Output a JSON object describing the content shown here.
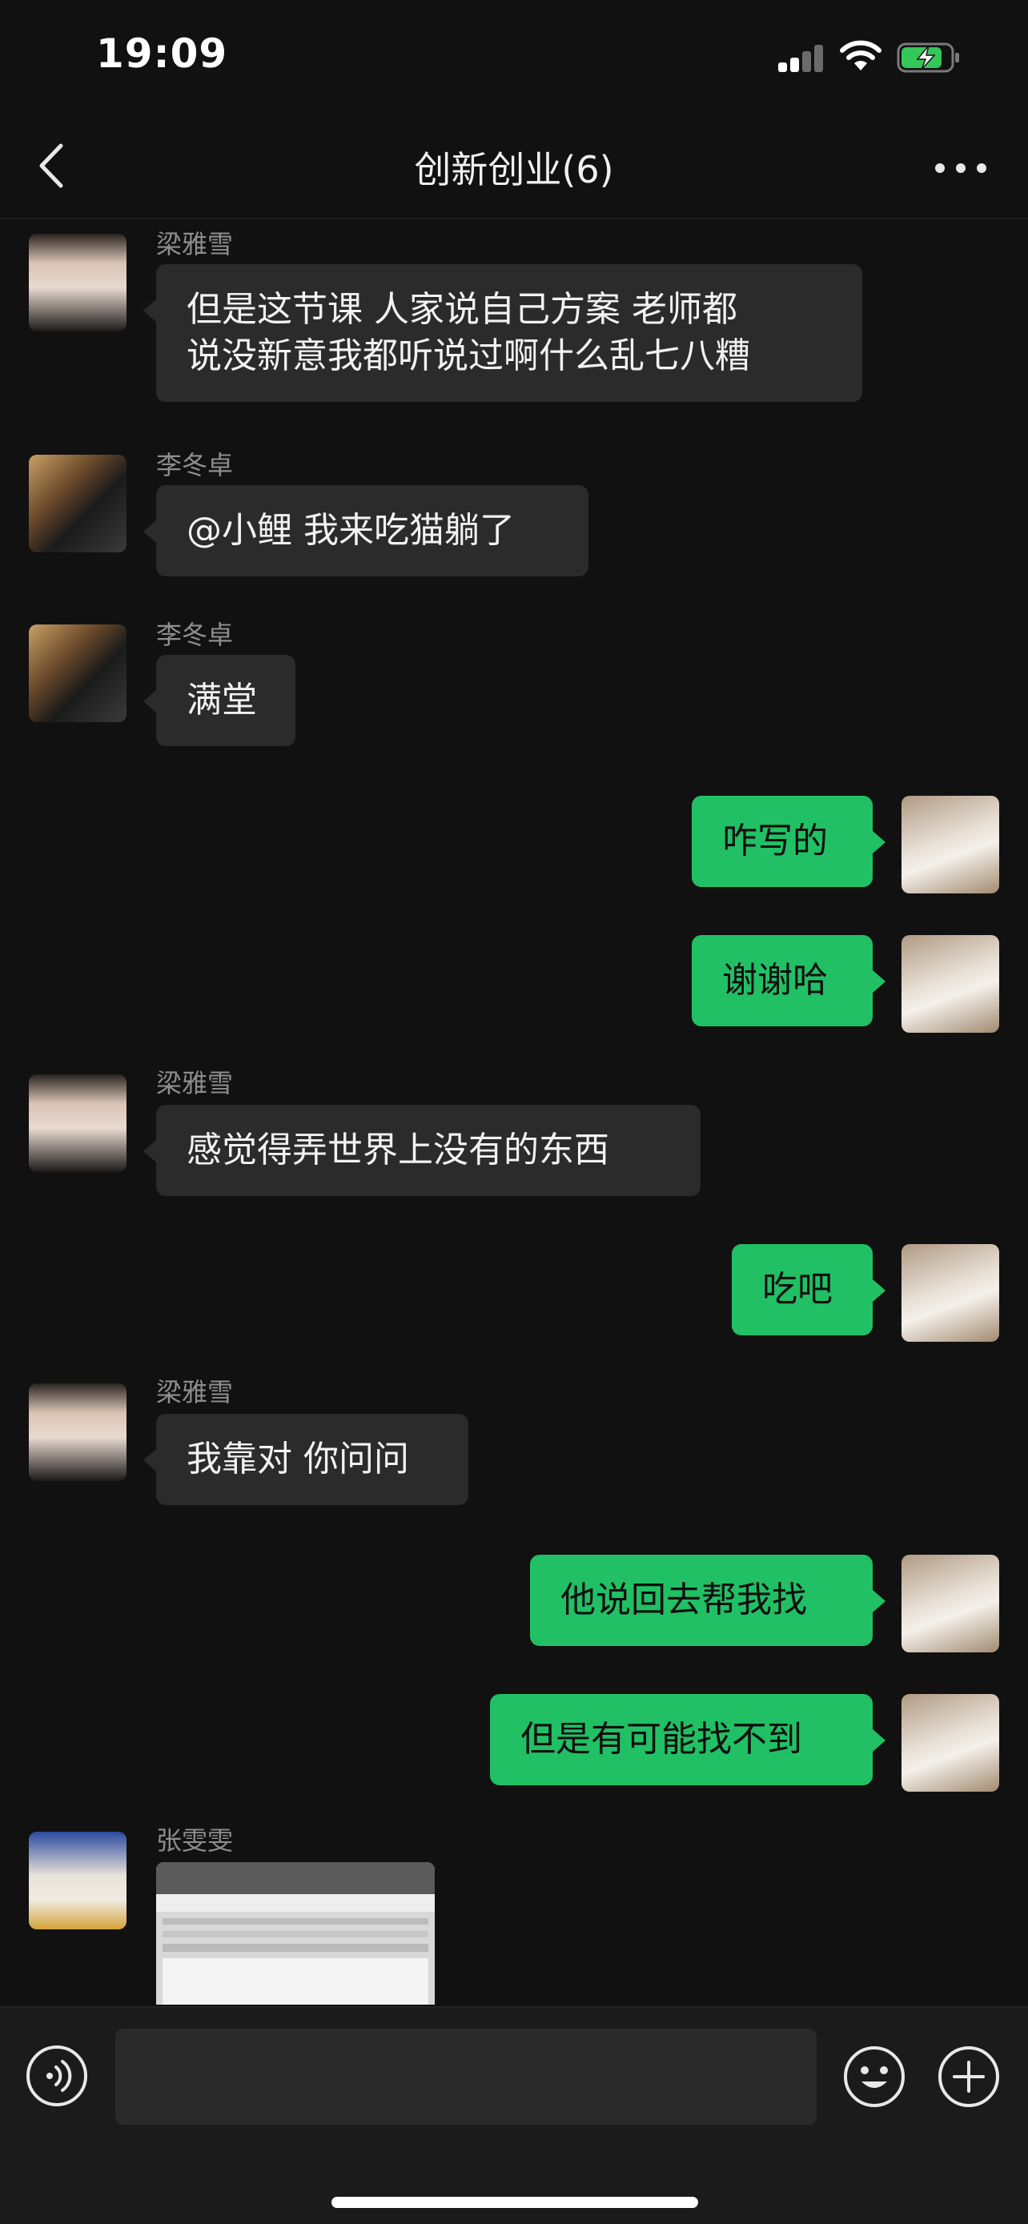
{
  "status_bar": {
    "time": "19:09"
  },
  "header": {
    "title": "创新创业(6)"
  },
  "messages": [
    {
      "side": "in",
      "sender": "梁雅雪",
      "text": "但是这节课 人家说自己方案 老师都\n说没新意我都听说过啊什么乱七八糟"
    },
    {
      "side": "in",
      "sender": "李冬卓",
      "text": "@小鲤 我来吃猫躺了"
    },
    {
      "side": "in",
      "sender": "李冬卓",
      "text": "满堂"
    },
    {
      "side": "out",
      "text": "咋写的"
    },
    {
      "side": "out",
      "text": "谢谢哈"
    },
    {
      "side": "in",
      "sender": "梁雅雪",
      "text": "感觉得弄世界上没有的东西"
    },
    {
      "side": "out",
      "text": "吃吧"
    },
    {
      "side": "in",
      "sender": "梁雅雪",
      "text": "我靠对 你问问"
    },
    {
      "side": "out",
      "text": "他说回去帮我找"
    },
    {
      "side": "out",
      "text": "但是有可能找不到"
    },
    {
      "side": "in",
      "sender": "张雯雯",
      "type": "image",
      "image_alt": "document-screenshot"
    }
  ],
  "input_bar": {
    "value": "",
    "placeholder": ""
  },
  "colors": {
    "outgoing_bubble": "#21c064",
    "incoming_bubble": "#2b2b2b",
    "background": "#111111"
  }
}
